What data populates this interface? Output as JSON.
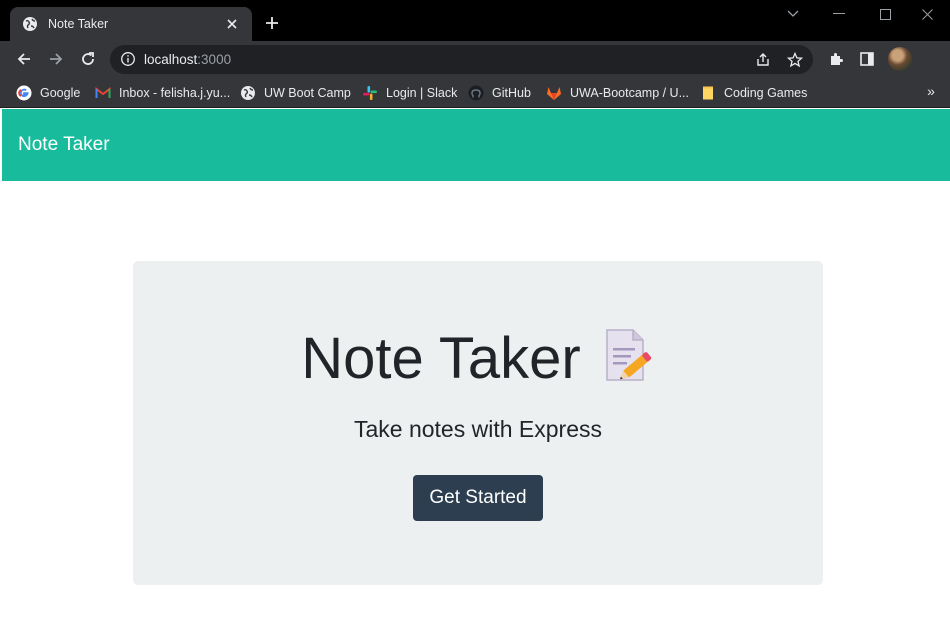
{
  "browser": {
    "tab": {
      "title": "Note Taker",
      "favicon": "globe-icon"
    },
    "address_bar": {
      "host": "localhost",
      "port": ":3000",
      "info_icon": "info-icon"
    },
    "bookmarks": [
      {
        "label": "Google",
        "icon": "google-icon"
      },
      {
        "label": "Inbox - felisha.j.yu...",
        "icon": "gmail-icon"
      },
      {
        "label": "UW Boot Camp",
        "icon": "globe-icon"
      },
      {
        "label": "Login | Slack",
        "icon": "slack-icon"
      },
      {
        "label": "GitHub",
        "icon": "github-icon"
      },
      {
        "label": "UWA-Bootcamp / U...",
        "icon": "gitlab-icon"
      },
      {
        "label": "Coding Games",
        "icon": "folder-icon"
      }
    ],
    "bookmarks_overflow": "»"
  },
  "page": {
    "navbar": {
      "brand": "Note Taker"
    },
    "jumbotron": {
      "title": "Note Taker",
      "emoji": "memo-icon",
      "lead": "Take notes with Express",
      "button_label": "Get Started"
    }
  },
  "colors": {
    "navbar": "#18bc9c",
    "jumbotron_bg": "#ecf0f1",
    "button_bg": "#2c3e50",
    "chrome_dark": "#35363a"
  }
}
